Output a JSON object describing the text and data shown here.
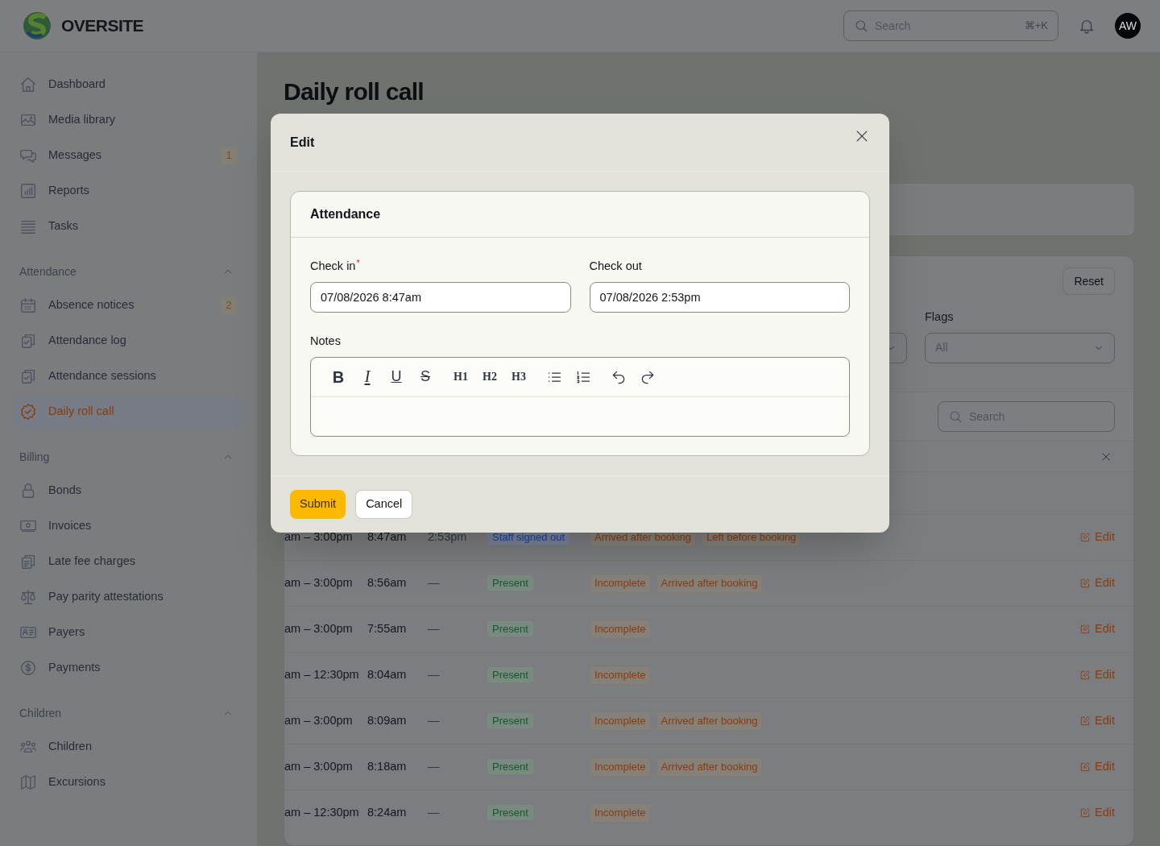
{
  "header": {
    "brand": "OVERSITE",
    "search": {
      "placeholder": "Search",
      "shortcut": "⌘+K"
    },
    "avatar": "AW"
  },
  "sidebar": {
    "groups": [
      {
        "items": [
          {
            "label": "Dashboard",
            "selected": false
          },
          {
            "label": "Media library",
            "selected": false
          },
          {
            "label": "Messages",
            "badge": "1",
            "selected": false
          },
          {
            "label": "Reports",
            "selected": false
          },
          {
            "label": "Tasks",
            "selected": false
          }
        ]
      },
      {
        "title": "Attendance",
        "expanded": true,
        "items": [
          {
            "label": "Absence notices",
            "badge": "2",
            "selected": false
          },
          {
            "label": "Attendance log",
            "selected": false
          },
          {
            "label": "Attendance sessions",
            "selected": false
          },
          {
            "label": "Daily roll call",
            "selected": true
          }
        ]
      },
      {
        "title": "Billing",
        "expanded": true,
        "items": [
          {
            "label": "Bonds",
            "selected": false
          },
          {
            "label": "Invoices",
            "selected": false
          },
          {
            "label": "Late fee charges",
            "selected": false
          },
          {
            "label": "Pay parity attestations",
            "selected": false
          },
          {
            "label": "Payers",
            "selected": false
          },
          {
            "label": "Payments",
            "selected": false
          }
        ]
      },
      {
        "title": "Children",
        "expanded": true,
        "items": [
          {
            "label": "Children",
            "selected": false
          },
          {
            "label": "Excursions",
            "selected": false
          }
        ]
      }
    ]
  },
  "page": {
    "title": "Daily roll call"
  },
  "filters": {
    "reset": "Reset",
    "flags": {
      "label": "Flags",
      "value": "All"
    },
    "search": {
      "placeholder": "Search"
    }
  },
  "table": {
    "rows": [
      {
        "booking": "am – 3:00pm",
        "check_in": "8:47am",
        "check_out": "2:53pm",
        "status": {
          "label": "Staff signed out",
          "kind": "signed_out"
        },
        "flags": [
          "Arrived after booking",
          "Left before booking"
        ],
        "action": "Edit"
      },
      {
        "booking": "am – 3:00pm",
        "check_in": "8:56am",
        "check_out": "—",
        "status": {
          "label": "Present",
          "kind": "present"
        },
        "flags": [
          "Incomplete",
          "Arrived after booking"
        ],
        "action": "Edit"
      },
      {
        "booking": "am – 3:00pm",
        "check_in": "7:55am",
        "check_out": "—",
        "status": {
          "label": "Present",
          "kind": "present"
        },
        "flags": [
          "Incomplete"
        ],
        "action": "Edit"
      },
      {
        "booking": "am – 12:30pm",
        "check_in": "8:04am",
        "check_out": "—",
        "status": {
          "label": "Present",
          "kind": "present"
        },
        "flags": [
          "Incomplete"
        ],
        "action": "Edit"
      },
      {
        "booking": "am – 3:00pm",
        "check_in": "8:09am",
        "check_out": "—",
        "status": {
          "label": "Present",
          "kind": "present"
        },
        "flags": [
          "Incomplete",
          "Arrived after booking"
        ],
        "action": "Edit"
      },
      {
        "booking": "am – 3:00pm",
        "check_in": "8:18am",
        "check_out": "—",
        "status": {
          "label": "Present",
          "kind": "present"
        },
        "flags": [
          "Incomplete",
          "Arrived after booking"
        ],
        "action": "Edit"
      },
      {
        "booking": "am – 12:30pm",
        "check_in": "8:24am",
        "check_out": "—",
        "status": {
          "label": "Present",
          "kind": "present"
        },
        "flags": [
          "Incomplete"
        ],
        "action": "Edit"
      }
    ]
  },
  "modal": {
    "title": "Edit",
    "section": "Attendance",
    "fields": [
      {
        "label": "Check in",
        "required_mark": "*",
        "value": "07/08/2026 8:47am"
      },
      {
        "label": "Check out",
        "value": "07/08/2026 2:53pm"
      }
    ],
    "notes": {
      "label": "Notes",
      "toolbar": [
        {
          "kind": "bold",
          "label": "B"
        },
        {
          "kind": "italic",
          "label": "I"
        },
        {
          "kind": "underline",
          "label": "U"
        },
        {
          "kind": "strike",
          "label": "S"
        },
        {
          "kind": "heading",
          "label": "H1"
        },
        {
          "kind": "heading",
          "label": "H2"
        },
        {
          "kind": "heading",
          "label": "H3"
        },
        {
          "kind": "bullets"
        },
        {
          "kind": "numbers"
        },
        {
          "kind": "undo"
        },
        {
          "kind": "redo"
        }
      ]
    },
    "buttons": [
      {
        "label": "Submit",
        "kind": "primary"
      },
      {
        "label": "Cancel",
        "kind": "secondary"
      }
    ]
  }
}
